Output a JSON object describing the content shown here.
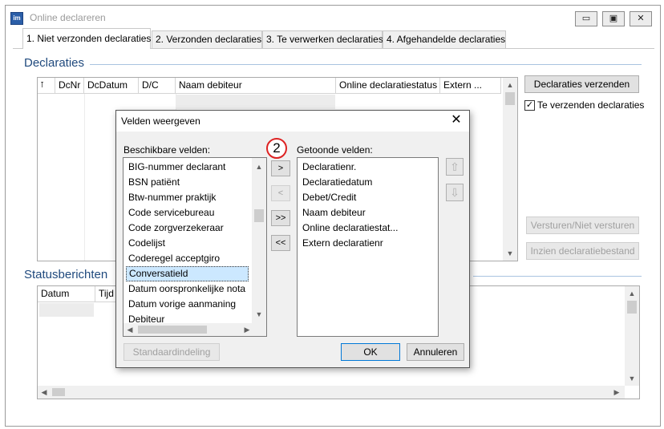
{
  "window": {
    "title": "Online declareren",
    "app_icon_label": "im",
    "minimize": "▭",
    "restore": "▣",
    "close": "✕"
  },
  "tabs": [
    {
      "label": "1. Niet verzonden declaraties",
      "active": true
    },
    {
      "label": "2. Verzonden declaraties"
    },
    {
      "label": "3. Te verwerken declaraties"
    },
    {
      "label": "4. Afgehandelde declaraties"
    }
  ],
  "declaraties": {
    "title": "Declaraties",
    "columns": [
      "DcNr",
      "DcDatum",
      "D/C",
      "Naam debiteur",
      "Online declaratiestatus",
      "Extern ..."
    ]
  },
  "right_panel": {
    "send_button": "Declaraties verzenden",
    "checkbox_label": "Te verzenden declaraties",
    "checkbox_checked": "✓",
    "versturen_button": "Versturen/Niet versturen",
    "inzien_button": "Inzien declaratiebestand"
  },
  "status": {
    "title": "Statusberichten",
    "columns": [
      "Datum",
      "Tijd"
    ]
  },
  "dialog": {
    "title": "Velden weergeven",
    "close": "✕",
    "available_label": "Beschikbare velden:",
    "shown_label": "Getoonde velden:",
    "available_fields": [
      "BIG-nummer declarant",
      "BSN patiënt",
      "Btw-nummer praktijk",
      "Code servicebureau",
      "Code zorgverzekeraar",
      "Codelijst",
      "Coderegel acceptgiro",
      "Conversatield",
      "Datum oorspronkelijke nota",
      "Datum vorige aanmaning",
      "Debiteur"
    ],
    "selected_available": "Conversatield",
    "shown_fields": [
      "Declaratienr.",
      "Declaratiedatum",
      "Debet/Credit",
      "Naam debiteur",
      "Online declaratiestat...",
      "Extern declaratienr"
    ],
    "move_right": ">",
    "move_left": "<",
    "move_all_right": ">>",
    "move_all_left": "<<",
    "step_marker": "2",
    "default_button": "Standaardindeling",
    "ok_button": "OK",
    "cancel_button": "Annuleren"
  }
}
